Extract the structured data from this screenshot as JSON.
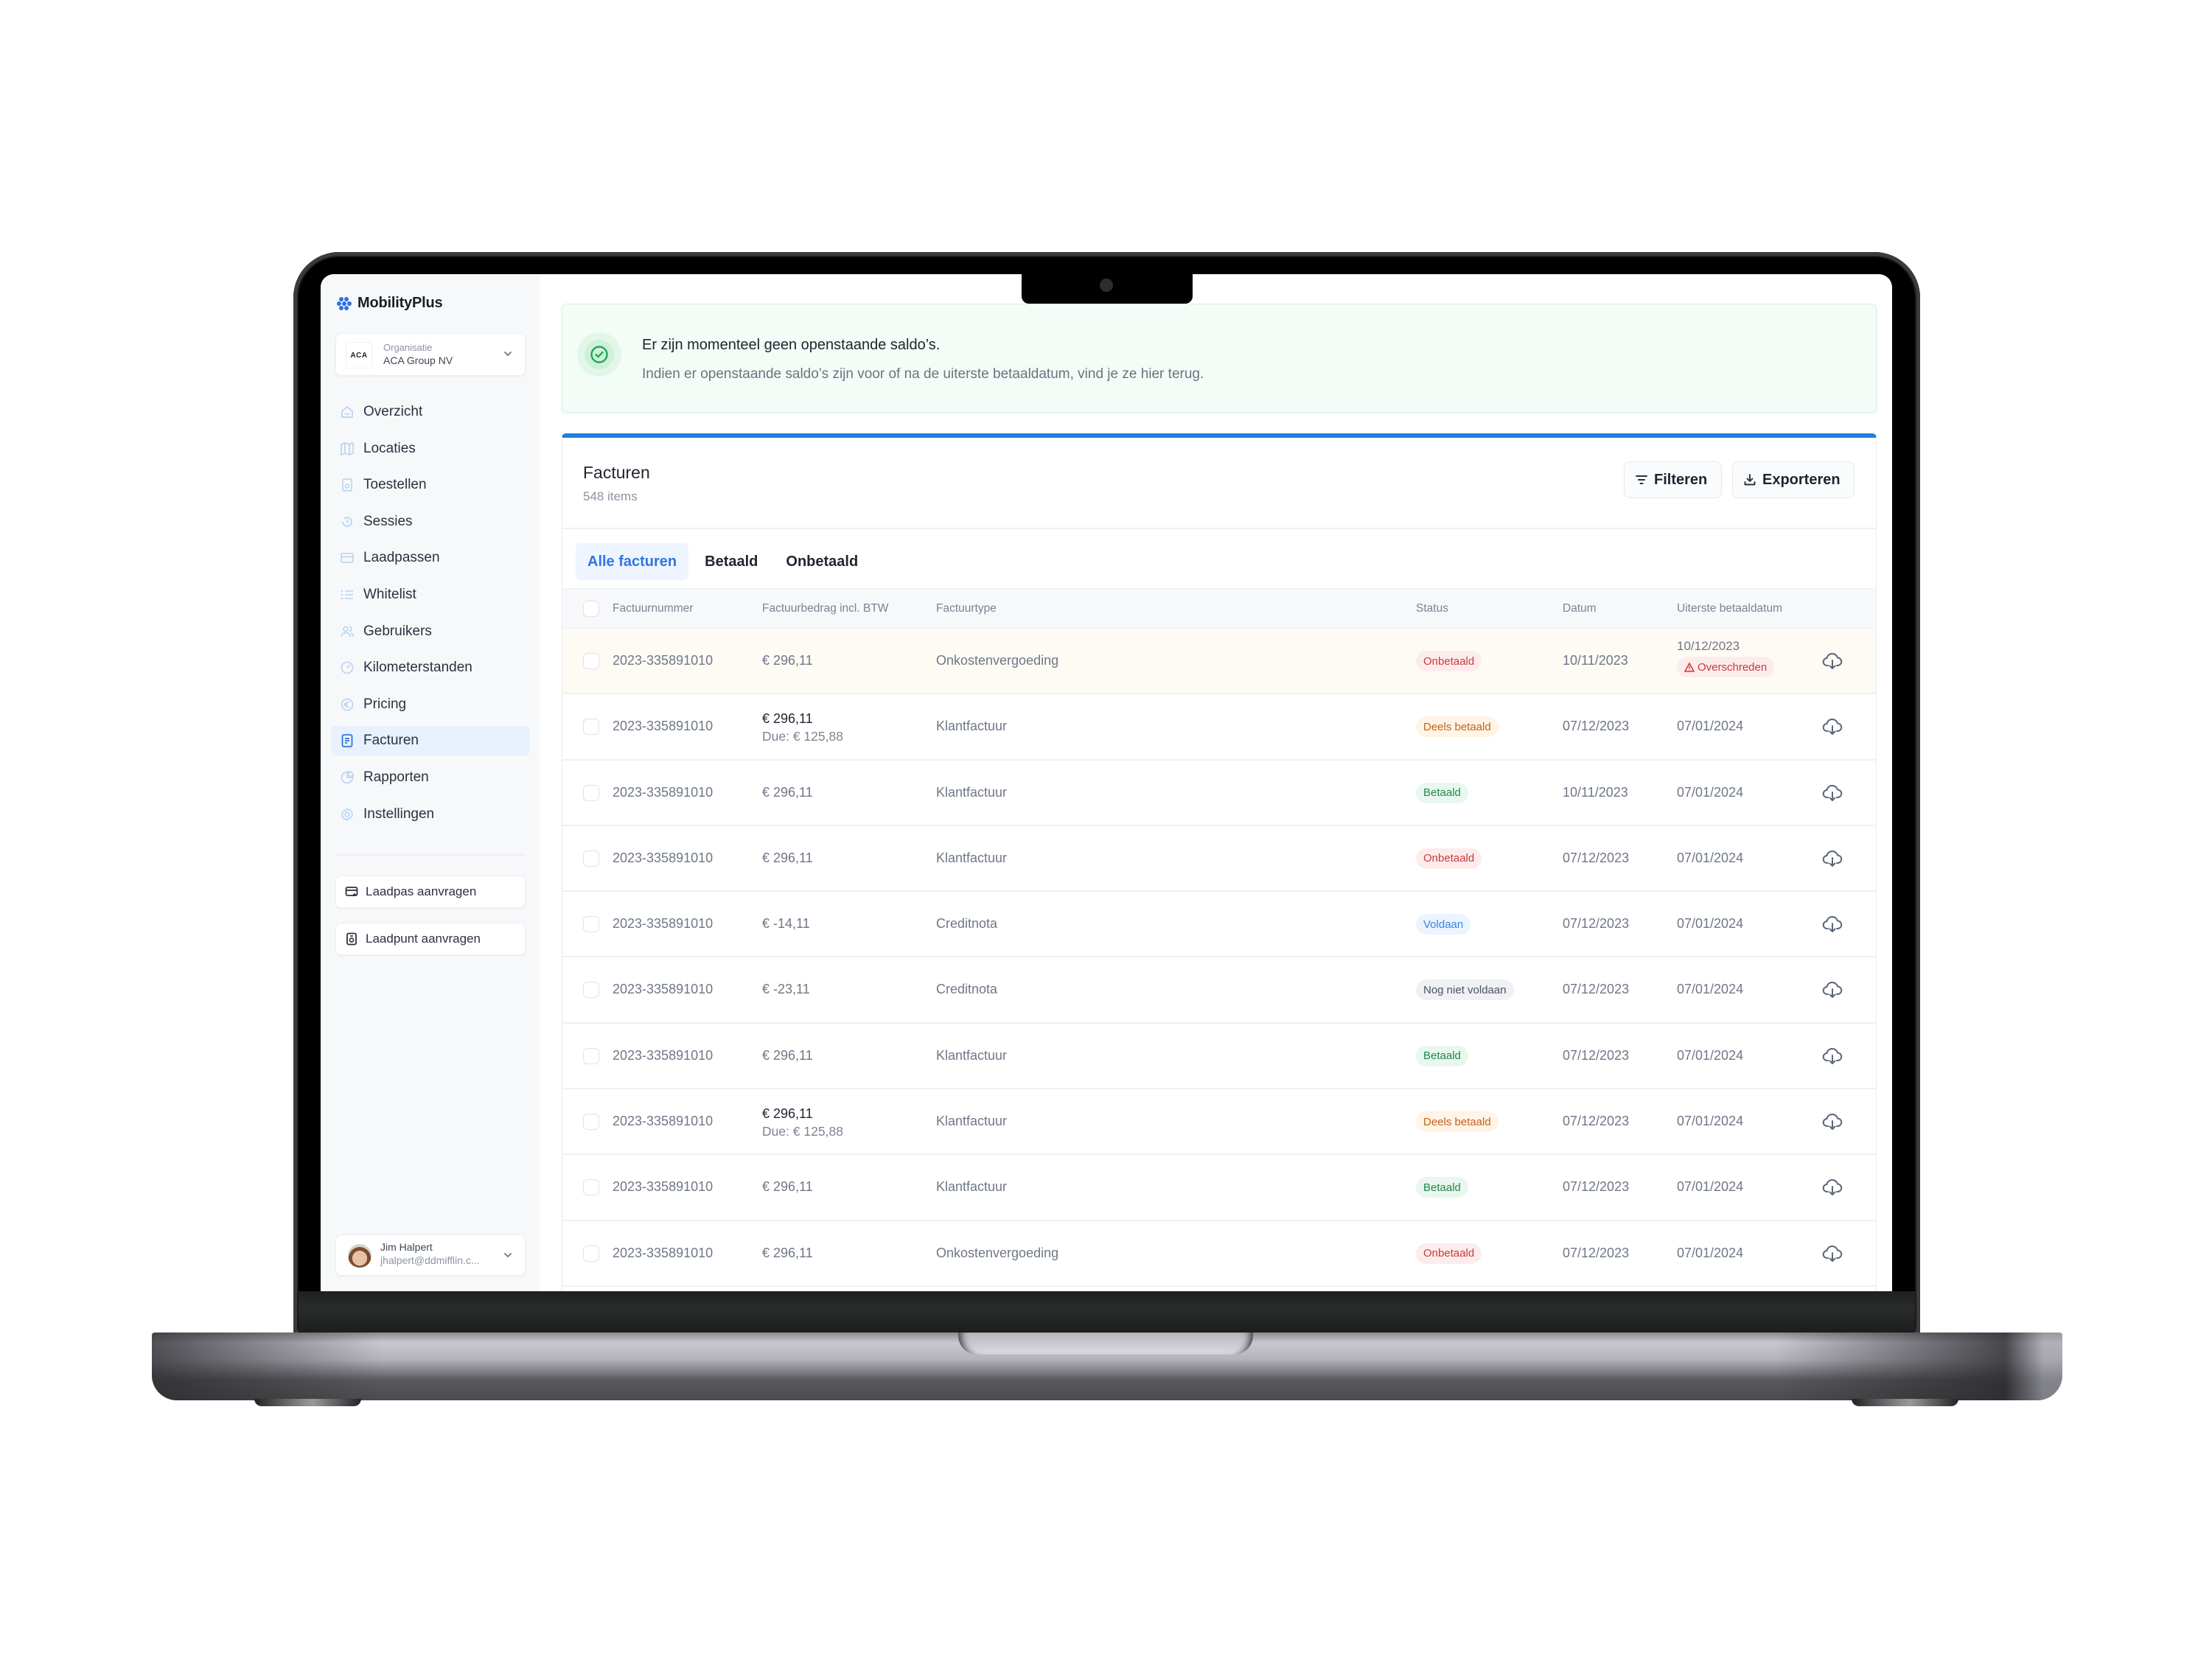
{
  "app": {
    "name": "MobilityPlus",
    "brand_color": "#2f6fe4",
    "accent_color": "#1e7fe0"
  },
  "organisation": {
    "label": "Organisatie",
    "name": "ACA Group NV",
    "logo_text": "ACA"
  },
  "sidebar": {
    "items": [
      {
        "label": "Overzicht",
        "icon": "home-icon"
      },
      {
        "label": "Locaties",
        "icon": "map-icon"
      },
      {
        "label": "Toestellen",
        "icon": "charger-icon"
      },
      {
        "label": "Sessies",
        "icon": "history-icon"
      },
      {
        "label": "Laadpassen",
        "icon": "card-icon"
      },
      {
        "label": "Whitelist",
        "icon": "list-icon"
      },
      {
        "label": "Gebruikers",
        "icon": "users-icon"
      },
      {
        "label": "Kilometerstanden",
        "icon": "gauge-icon"
      },
      {
        "label": "Pricing",
        "icon": "euro-icon"
      },
      {
        "label": "Facturen",
        "icon": "invoice-icon",
        "active": true
      },
      {
        "label": "Rapporten",
        "icon": "pie-chart-icon"
      },
      {
        "label": "Instellingen",
        "icon": "gear-icon"
      }
    ],
    "actions": [
      {
        "label": "Laadpas aanvragen",
        "icon": "card-add-icon"
      },
      {
        "label": "Laadpunt aanvragen",
        "icon": "charger-icon"
      }
    ],
    "user": {
      "name": "Jim Halpert",
      "email": "jhalpert@ddmifflin.c..."
    }
  },
  "alert": {
    "title": "Er zijn momenteel geen openstaande saldo’s.",
    "description": "Indien er openstaande saldo’s zijn voor of na de uiterste betaaldatum, vind je ze hier terug.",
    "icon": "check-circle-icon"
  },
  "invoices": {
    "title": "Facturen",
    "count": "548 items",
    "filter_label": "Filteren",
    "export_label": "Exporteren",
    "tabs": [
      {
        "label": "Alle facturen",
        "active": true
      },
      {
        "label": "Betaald"
      },
      {
        "label": "Onbetaald"
      }
    ],
    "columns": [
      "Factuurnummer",
      "Factuurbedrag incl. BTW",
      "Factuurtype",
      "Status",
      "Datum",
      "Uiterste betaaldatum"
    ],
    "status_styles": {
      "Onbetaald": {
        "bg": "#fdecec",
        "fg": "#c93a3a"
      },
      "Deels betaald": {
        "bg": "#fff4e5",
        "fg": "#c2621c"
      },
      "Betaald": {
        "bg": "#e8f8ee",
        "fg": "#23854a"
      },
      "Voldaan": {
        "bg": "#ebf4ff",
        "fg": "#2f86e8"
      },
      "Nog niet voldaan": {
        "bg": "#eff1f5",
        "fg": "#4b5262"
      }
    },
    "rows": [
      {
        "number": "2023-335891010",
        "amount": "€ 296,11",
        "due": "",
        "type": "Onkostenvergoeding",
        "status": "Onbetaald",
        "date": "10/11/2023",
        "deadline": "10/12/2023",
        "overdue": "Overschreden"
      },
      {
        "number": "2023-335891010",
        "amount": "€ 296,11",
        "due": "Due: € 125,88",
        "type": "Klantfactuur",
        "status": "Deels betaald",
        "date": "07/12/2023",
        "deadline": "07/01/2024",
        "overdue": ""
      },
      {
        "number": "2023-335891010",
        "amount": "€ 296,11",
        "due": "",
        "type": "Klantfactuur",
        "status": "Betaald",
        "date": "10/11/2023",
        "deadline": "07/01/2024",
        "overdue": ""
      },
      {
        "number": "2023-335891010",
        "amount": "€ 296,11",
        "due": "",
        "type": "Klantfactuur",
        "status": "Onbetaald",
        "date": "07/12/2023",
        "deadline": "07/01/2024",
        "overdue": ""
      },
      {
        "number": "2023-335891010",
        "amount": "€ -14,11",
        "due": "",
        "type": "Creditnota",
        "status": "Voldaan",
        "date": "07/12/2023",
        "deadline": "07/01/2024",
        "overdue": ""
      },
      {
        "number": "2023-335891010",
        "amount": "€ -23,11",
        "due": "",
        "type": "Creditnota",
        "status": "Nog niet voldaan",
        "date": "07/12/2023",
        "deadline": "07/01/2024",
        "overdue": ""
      },
      {
        "number": "2023-335891010",
        "amount": "€ 296,11",
        "due": "",
        "type": "Klantfactuur",
        "status": "Betaald",
        "date": "07/12/2023",
        "deadline": "07/01/2024",
        "overdue": ""
      },
      {
        "number": "2023-335891010",
        "amount": "€ 296,11",
        "due": "Due: € 125,88",
        "type": "Klantfactuur",
        "status": "Deels betaald",
        "date": "07/12/2023",
        "deadline": "07/01/2024",
        "overdue": ""
      },
      {
        "number": "2023-335891010",
        "amount": "€ 296,11",
        "due": "",
        "type": "Klantfactuur",
        "status": "Betaald",
        "date": "07/12/2023",
        "deadline": "07/01/2024",
        "overdue": ""
      },
      {
        "number": "2023-335891010",
        "amount": "€ 296,11",
        "due": "",
        "type": "Onkostenvergoeding",
        "status": "Onbetaald",
        "date": "07/12/2023",
        "deadline": "07/01/2024",
        "overdue": ""
      }
    ]
  }
}
